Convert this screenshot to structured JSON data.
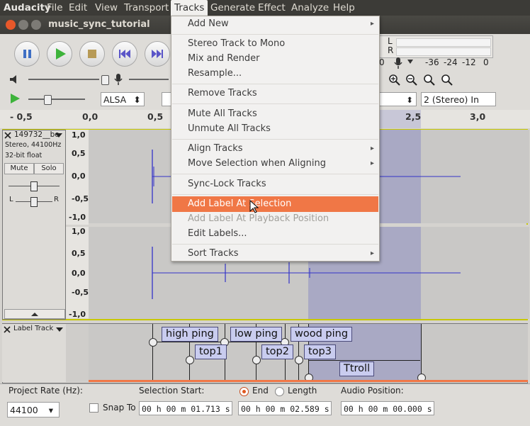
{
  "menubar": {
    "app": "Audacity",
    "items": [
      "File",
      "Edit",
      "View",
      "Transport",
      "Tracks",
      "Generate",
      "Effect",
      "Analyze",
      "Help"
    ]
  },
  "window": {
    "title": "music_sync_tutorial"
  },
  "meter": {
    "left_label": "L",
    "right_label": "R",
    "scale": [
      "-36",
      "-24",
      "-12",
      "0"
    ],
    "recording_fragment": "0"
  },
  "device": {
    "host": "ALSA",
    "channels": "2 (Stereo) In"
  },
  "ruler": {
    "ticks": [
      "- 0,5",
      "0,0",
      "0,5",
      "2,5",
      "3,0"
    ]
  },
  "audio_track": {
    "name": "149732__be",
    "info1": "Stereo, 44100Hz",
    "info2": "32-bit float",
    "mute": "Mute",
    "solo": "Solo",
    "gain_l": "L",
    "gain_r": "R",
    "scale": [
      "1,0",
      "0,5",
      "0,0",
      "-0,5",
      "-1,0"
    ]
  },
  "label_track": {
    "name": "Label Track",
    "labels": [
      "high ping",
      "low ping",
      "wood ping",
      "top1",
      "top2",
      "top3",
      "Ttroll"
    ]
  },
  "tracks_menu": {
    "items": [
      {
        "label": "Add New",
        "submenu": true
      },
      {
        "label": "Stereo Track to Mono"
      },
      {
        "label": "Mix and Render"
      },
      {
        "label": "Resample..."
      },
      {
        "label": "Remove Tracks"
      },
      {
        "label": "Mute All Tracks"
      },
      {
        "label": "Unmute All Tracks"
      },
      {
        "label": "Align Tracks",
        "submenu": true
      },
      {
        "label": "Move Selection when Aligning",
        "submenu": true
      },
      {
        "label": "Sync-Lock Tracks"
      },
      {
        "label": "Add Label At Selection",
        "highlighted": true
      },
      {
        "label": "Add Label At Playback Position",
        "disabled": true
      },
      {
        "label": "Edit Labels..."
      },
      {
        "label": "Sort Tracks",
        "submenu": true
      }
    ]
  },
  "selection_bar": {
    "project_rate_label": "Project Rate (Hz):",
    "project_rate": "44100",
    "snap_to": "Snap To",
    "selection_start_label": "Selection Start:",
    "end_label": "End",
    "length_label": "Length",
    "audio_position_label": "Audio Position:",
    "start_value": "00 h 00 m 01.713 s",
    "end_value": "00 h 00 m 02.589 s",
    "position_value": "00 h 00 m 00.000 s"
  }
}
